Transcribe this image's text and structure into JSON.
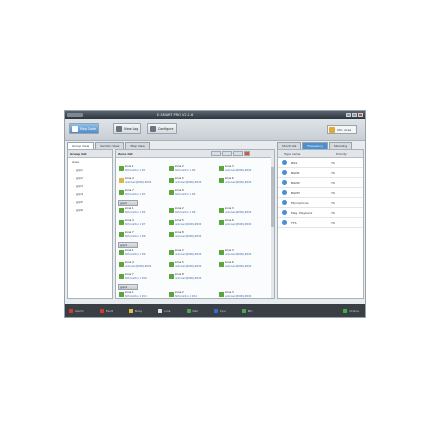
{
  "window": {
    "title": "E-SMART PRO V2.1.6"
  },
  "toolbar": {
    "buttons": [
      {
        "label": "Map Code",
        "color": "#4e8dc8",
        "active": true
      },
      {
        "label": "View Log",
        "color": "#6b7580",
        "active": false
      },
      {
        "label": "Configure",
        "color": "#6b7580",
        "active": false
      }
    ],
    "user_label": "Ctrl. Area"
  },
  "tabs": {
    "left": [
      "Group View",
      "Section View",
      "Map View"
    ],
    "right": [
      "Shortcuts",
      "Frequency",
      "Standing"
    ]
  },
  "groups_pane": {
    "header": "Group list",
    "root": "Area",
    "items": [
      "grp1",
      "grp2",
      "grp3",
      "grp4",
      "grp5",
      "grp6"
    ]
  },
  "zones_pane": {
    "header": "Zone list",
    "groups": [
      {
        "label": "",
        "zones": [
          {
            "icon": "green",
            "name": "zone 1",
            "sub": "SCS built-in 1 #1"
          },
          {
            "icon": "green",
            "name": "zone 2",
            "sub": "SCS built-in 1 #2"
          },
          {
            "icon": "green",
            "name": "zone 3",
            "sub": "unknown[0000]-#000"
          },
          {
            "icon": "folder",
            "name": "zone 4",
            "sub": "unknown[0000]-#000"
          },
          {
            "icon": "green",
            "name": "zone 5",
            "sub": "unknown[0000]-#000"
          },
          {
            "icon": "green",
            "name": "zone 6",
            "sub": "unknown[0000]-#000"
          },
          {
            "icon": "green",
            "name": "zone 7",
            "sub": "SCS built-in 1 #3"
          },
          {
            "icon": "green",
            "name": "zone 8",
            "sub": "SCS built-in 1 #4"
          }
        ]
      },
      {
        "label": "grp2",
        "zones": [
          {
            "icon": "green",
            "name": "zone 1",
            "sub": "SCS built-in 1 #5"
          },
          {
            "icon": "green",
            "name": "zone 2",
            "sub": "SCS built-in 1 #6"
          },
          {
            "icon": "green",
            "name": "zone 3",
            "sub": "unknown[0000]-#000"
          },
          {
            "icon": "green",
            "name": "zone 4",
            "sub": "SCS built-in 1 #7"
          },
          {
            "icon": "green",
            "name": "zone 5",
            "sub": "unknown[0000]-#000"
          },
          {
            "icon": "green",
            "name": "zone 6",
            "sub": "unknown[0000]-#000"
          },
          {
            "icon": "green",
            "name": "zone 7",
            "sub": "SCS built-in 1 #8"
          },
          {
            "icon": "green",
            "name": "zone 8",
            "sub": "unknown[0000]-#000"
          }
        ]
      },
      {
        "label": "grp3",
        "zones": [
          {
            "icon": "green",
            "name": "zone 1",
            "sub": "SCS built-in 1 #9"
          },
          {
            "icon": "green",
            "name": "zone 2",
            "sub": "unknown[0000]-#000"
          },
          {
            "icon": "green",
            "name": "zone 3",
            "sub": "unknown[0000]-#000"
          },
          {
            "icon": "green",
            "name": "zone 4",
            "sub": "unknown[0000]-#000"
          },
          {
            "icon": "green",
            "name": "zone 5",
            "sub": "unknown[0000]-#000"
          },
          {
            "icon": "green",
            "name": "zone 6",
            "sub": "unknown[0000]-#000"
          },
          {
            "icon": "green",
            "name": "zone 7",
            "sub": "SCS built-in 1 #10"
          },
          {
            "icon": "green",
            "name": "zone 8",
            "sub": "unknown[0000]-#000"
          }
        ]
      },
      {
        "label": "grp4",
        "zones": [
          {
            "icon": "green",
            "name": "zone 1",
            "sub": "SCS built-in 1 #11"
          },
          {
            "icon": "green",
            "name": "zone 2",
            "sub": "SCS built-in 1 #12"
          },
          {
            "icon": "green",
            "name": "zone 3",
            "sub": "unknown[0000]-#000"
          },
          {
            "icon": "green",
            "name": "zone 4",
            "sub": "SCS built-in 1 #13"
          },
          {
            "icon": "green",
            "name": "zone 5",
            "sub": "unknown[0000]-#000"
          },
          {
            "icon": "green",
            "name": "zone 6",
            "sub": "unknown[0000]-#000"
          }
        ]
      }
    ]
  },
  "right_pane": {
    "col_name": "Type name",
    "col_value": "Priority",
    "rows": [
      {
        "name": "BGS",
        "value": "70"
      },
      {
        "name": "BGM1",
        "value": "70"
      },
      {
        "name": "BGM2",
        "value": "70"
      },
      {
        "name": "BGM3",
        "value": "70"
      },
      {
        "name": "Microphone",
        "value": "70"
      },
      {
        "name": "Msg. Playback",
        "value": "70"
      },
      {
        "name": "TTS",
        "value": "70"
      }
    ]
  },
  "statusbar": {
    "items": [
      {
        "label": "Alarm",
        "color": "#d23a2a"
      },
      {
        "label": "Fault",
        "color": "#d23a2a"
      },
      {
        "label": "Busy",
        "color": "#e0c23a"
      },
      {
        "label": "Link",
        "color": "#e0e0e0"
      },
      {
        "label": "Net",
        "color": "#4aa84a"
      },
      {
        "label": "Cpu",
        "color": "#3a6ad0"
      },
      {
        "label": "Mic",
        "color": "#4aa84a"
      }
    ],
    "online_label": "Online",
    "online_color": "#3cb043"
  }
}
